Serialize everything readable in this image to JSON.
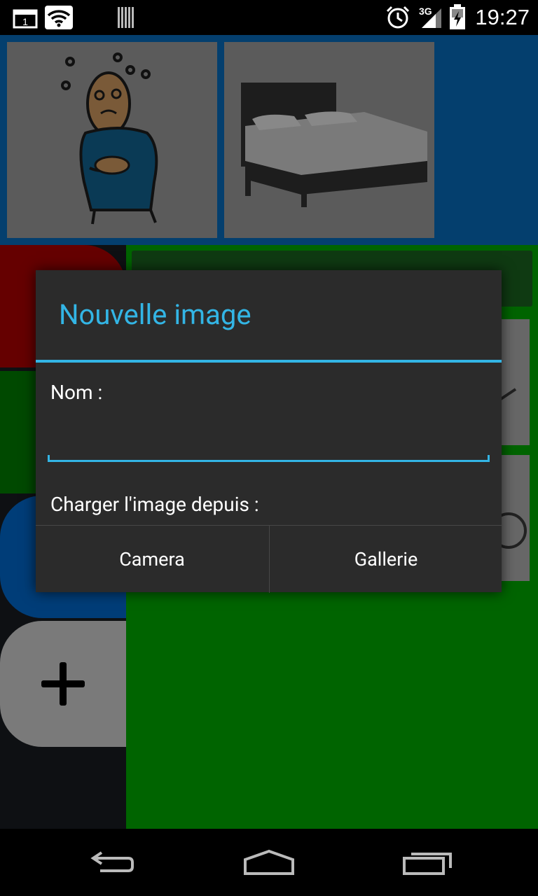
{
  "status_bar": {
    "time": "19:27",
    "network_label": "3G",
    "icons": [
      "calendar-icon",
      "wifi-icon",
      "barcode-icon",
      "alarm-icon",
      "signal-icon",
      "battery-icon"
    ]
  },
  "dialog": {
    "title": "Nouvelle image",
    "name_label": "Nom :",
    "name_value": "",
    "load_label": "Charger l'image depuis :",
    "camera_label": "Camera",
    "gallery_label": "Gallerie"
  },
  "navigation": {
    "icons": [
      "back-icon",
      "home-icon",
      "recent-apps-icon"
    ]
  },
  "colors": {
    "accent": "#33b5e5",
    "dialog_bg": "#2b2b2b",
    "top_strip": "#043f6e",
    "content_bg": "#006400"
  }
}
